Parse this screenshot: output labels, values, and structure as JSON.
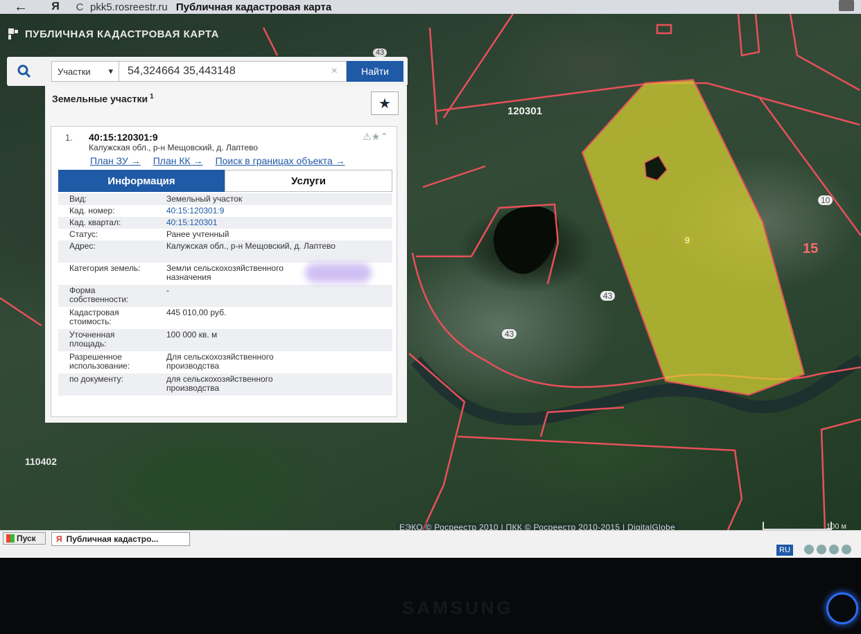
{
  "browser": {
    "back_glyph": "←",
    "yandex_glyph": "Я",
    "reload_glyph": "C",
    "url": "pkk5.rosreestr.ru",
    "page_title": "Публичная кадастровая карта"
  },
  "map": {
    "app_title": "ПУБЛИЧНАЯ КАДАСТРОВАЯ КАРТА",
    "labels": {
      "block_120301": "120301",
      "parcel_9": "9",
      "parcel_10": "10",
      "district_15": "15",
      "parcel_43a": "43",
      "parcel_43b": "43",
      "parcel_43_top": "43",
      "block_110402": "110402"
    },
    "attribution": "ЕЭКО © Росреестр 2010 | ПКК © Росреестр 2010-2015 | DigitalGlobe",
    "scale_label": "100 м",
    "colors": {
      "parcel_border": "#e8505a",
      "selected_fill": "#d8d431"
    }
  },
  "search": {
    "layer_select": "Участки",
    "query": "54,324664 35,443148",
    "clear_glyph": "×",
    "find_button": "Найти"
  },
  "results": {
    "header": "Земельные участки",
    "count": "1",
    "favorite_glyph": "★",
    "item": {
      "index": "1.",
      "cad_number": "40:15:120301:9",
      "address": "Калужская обл., р-н Мещовский, д. Лаптево",
      "links": [
        "План ЗУ →",
        "План КК →",
        "Поиск в границах объекта →"
      ],
      "tools": "⚠★⌃"
    },
    "tabs": [
      "Информация",
      "Услуги"
    ],
    "rows": [
      {
        "k": "Вид:",
        "v": "Земельный участок"
      },
      {
        "k": "Кад. номер:",
        "v": "40:15:120301:9"
      },
      {
        "k": "Кад. квартал:",
        "v": "40:15:120301"
      },
      {
        "k": "Статус:",
        "v": "Ранее учтенный"
      },
      {
        "k": "Адрес:",
        "v": "Калужская обл., р-н Мещовский, д. Лаптево"
      },
      {
        "k": "Категория земель:",
        "v": "Земли сельскохозяйственного назначения"
      },
      {
        "k": "Форма собственности:",
        "v": "-"
      },
      {
        "k": "Кадастровая стоимость:",
        "v": "445 010,00 руб."
      },
      {
        "k": "Уточненная площадь:",
        "v": "100 000 кв. м"
      },
      {
        "k": "Разрешенное использование:",
        "v": "Для сельскохозяйственного производства"
      },
      {
        "k": "по документу:",
        "v": "для сельскохозяйственного производства"
      }
    ]
  },
  "taskbar": {
    "start": "Пуск",
    "task": "Публичная кадастро...",
    "lang": "RU"
  },
  "monitor": {
    "brand": "SAMSUNG"
  }
}
